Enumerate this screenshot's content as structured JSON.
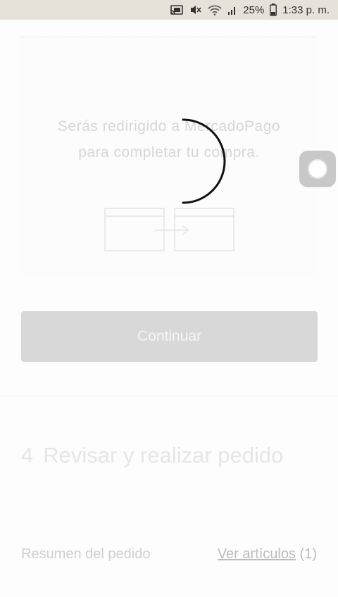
{
  "status_bar": {
    "battery_percent": "25%",
    "time": "1:33 p. m.",
    "icons": [
      "cast-icon",
      "mute-icon",
      "wifi-icon",
      "signal-icon",
      "battery-icon"
    ]
  },
  "redirect_panel": {
    "message": "Serás redirigido a MercadoPago para completar tu compra."
  },
  "continue_button": {
    "label": "Continuar"
  },
  "step": {
    "number": "4",
    "title": "Revisar y realizar pedido"
  },
  "order_summary": {
    "label": "Resumen del pedido",
    "view_items_link": "Ver artículos",
    "item_count": "(1)"
  },
  "colors": {
    "status_bar_bg": "#e6e1d9",
    "button_bg": "#d8d8d8",
    "spinner": "#111111"
  }
}
